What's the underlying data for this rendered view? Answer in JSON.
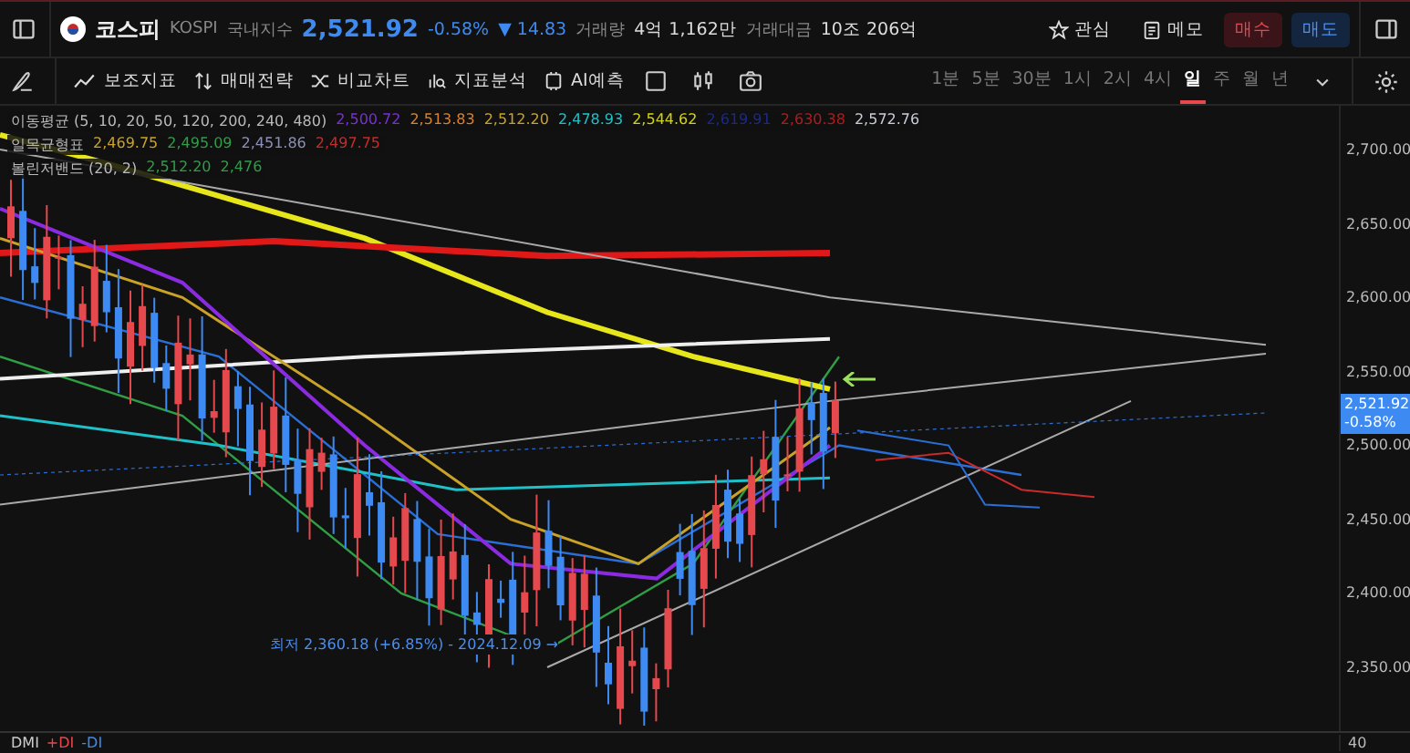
{
  "header": {
    "name": "코스피",
    "code": "KOSPI",
    "market": "국내지수",
    "price": "2,521.92",
    "change_pct": "-0.58%",
    "change": "14.83",
    "change_arrow": "▼",
    "stats": [
      {
        "label": "거래량",
        "value": "4억 1,162만"
      },
      {
        "label": "거래대금",
        "value": "10조 206억"
      }
    ],
    "actions": [
      {
        "label": "관심",
        "kind": "star"
      },
      {
        "label": "메모",
        "kind": "memo"
      },
      {
        "label": "매수",
        "kind": "buy"
      },
      {
        "label": "매도",
        "kind": "sell"
      }
    ]
  },
  "toolbar": {
    "tools": [
      {
        "label": "보조지표",
        "kind": "indicator"
      },
      {
        "label": "매매전략",
        "kind": "strategy"
      },
      {
        "label": "비교차트",
        "kind": "compare"
      },
      {
        "label": "지표분석",
        "kind": "analysis"
      },
      {
        "label": "AI예측",
        "kind": "ai"
      }
    ],
    "intervals": [
      {
        "label": "1분",
        "selected": false
      },
      {
        "label": "5분",
        "selected": false
      },
      {
        "label": "30분",
        "selected": false
      },
      {
        "label": "1시",
        "selected": false
      },
      {
        "label": "2시",
        "selected": false
      },
      {
        "label": "4시",
        "selected": false
      },
      {
        "label": "일",
        "selected": true
      },
      {
        "label": "주",
        "selected": false
      },
      {
        "label": "월",
        "selected": false
      },
      {
        "label": "년",
        "selected": false
      }
    ]
  },
  "legend": [
    {
      "title": "이동평균",
      "params": "(5, 10, 20, 50, 120, 200, 240, 480)",
      "values": [
        {
          "text": "2,500.72",
          "color": "#7b2fd6"
        },
        {
          "text": "2,513.83",
          "color": "#d9822b"
        },
        {
          "text": "2,512.20",
          "color": "#c9a227"
        },
        {
          "text": "2,478.93",
          "color": "#1fc1c9"
        },
        {
          "text": "2,544.62",
          "color": "#d4d40a"
        },
        {
          "text": "2,619.91",
          "color": "#1a2a8c"
        },
        {
          "text": "2,630.38",
          "color": "#b31b1b"
        },
        {
          "text": "2,572.76",
          "color": "#c8ccd8"
        }
      ]
    },
    {
      "title": "일목균형표",
      "values": [
        {
          "text": "2,469.75",
          "color": "#c9a227"
        },
        {
          "text": "2,495.09",
          "color": "#2f9e44"
        },
        {
          "text": "2,451.86",
          "color": "#8c90b8"
        },
        {
          "text": "2,497.75",
          "color": "#c92a2a"
        }
      ]
    },
    {
      "title": "볼린저밴드",
      "params": "(20, 2)",
      "values": [
        {
          "text": "2,512.20",
          "color": "#2f9e44"
        },
        {
          "text": "2,476",
          "color": "#2f9e44"
        }
      ]
    }
  ],
  "axis": {
    "ticks": [
      "2,700.00",
      "2,650.00",
      "2,600.00",
      "2,550.00",
      "2,500.00",
      "2,450.00",
      "2,400.00",
      "2,350.00"
    ],
    "price_tag": "2,521.92",
    "price_tag_change": "-0.58%"
  },
  "low_note": "최저 2,360.18 (+6.85%) - 2024.12.09 →",
  "dmi": {
    "title": "DMI",
    "plus": "+DI",
    "minus": "-DI",
    "tick": "40"
  }
}
